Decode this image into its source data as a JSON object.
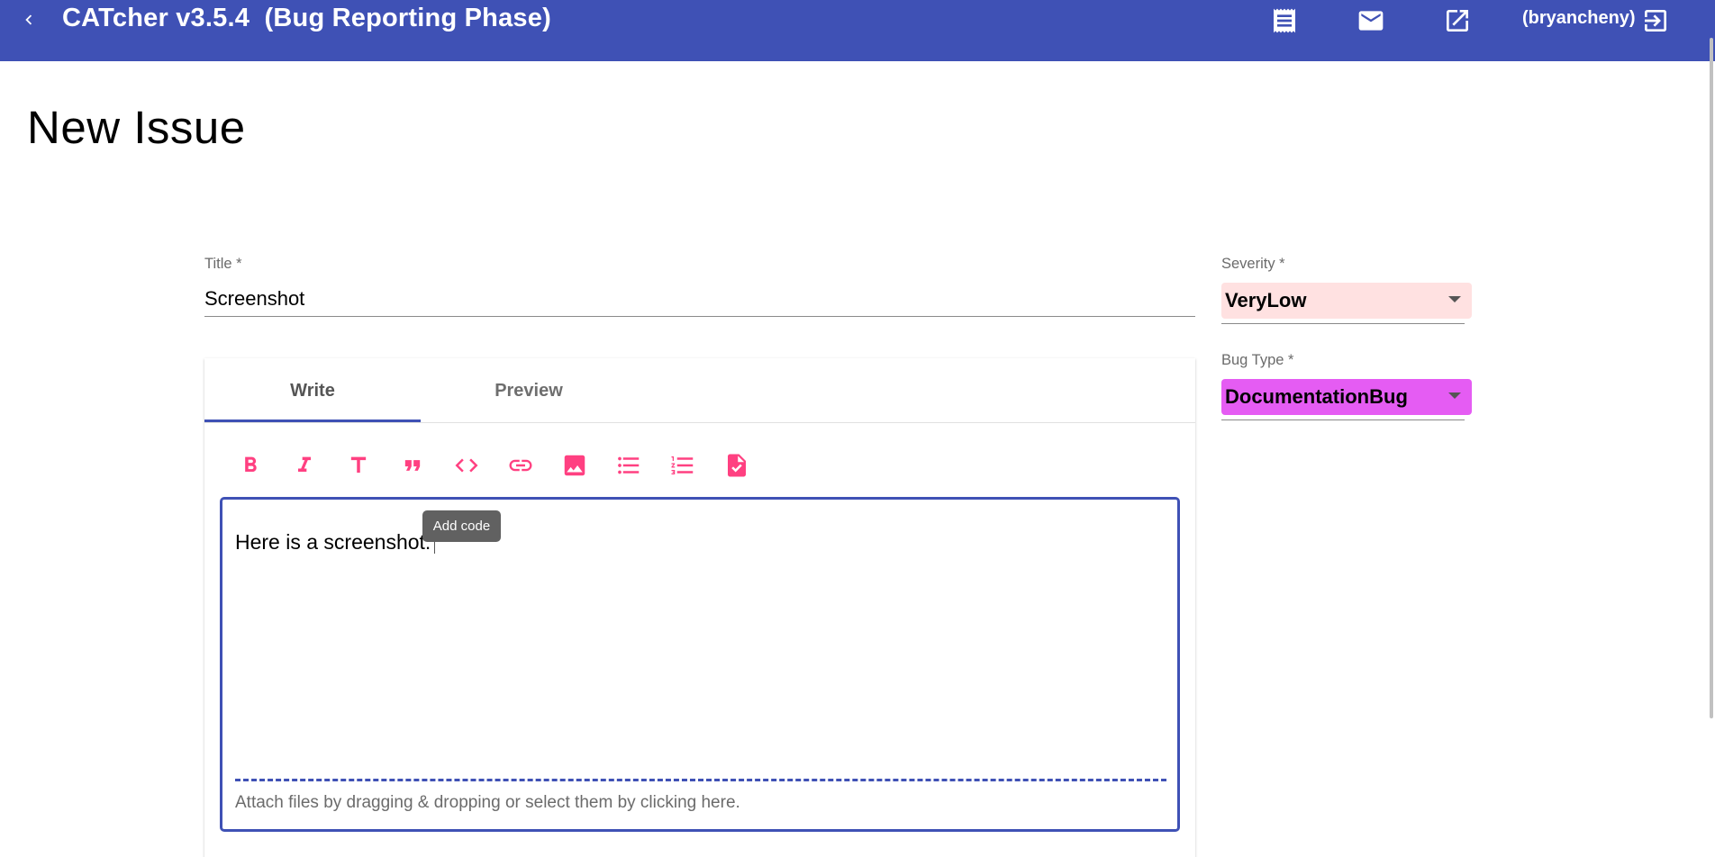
{
  "app": {
    "title": "CATcher v3.5.4  (Bug Reporting Phase)",
    "user": "(bryancheny)",
    "colors": {
      "primary": "#3f51b5",
      "accent": "#ff4081"
    }
  },
  "header_icons": [
    "back-chevron-icon",
    "receipt-icon",
    "mail-icon",
    "open-in-new-icon",
    "logout-icon"
  ],
  "page": {
    "title": "New Issue"
  },
  "form": {
    "title_label": "Title *",
    "title_value": "Screenshot",
    "tabs": [
      {
        "label": "Write",
        "active": true
      },
      {
        "label": "Preview",
        "active": false
      }
    ],
    "toolbar": [
      {
        "name": "bold-icon"
      },
      {
        "name": "italic-icon"
      },
      {
        "name": "heading-icon"
      },
      {
        "name": "quote-icon"
      },
      {
        "name": "code-icon"
      },
      {
        "name": "link-icon"
      },
      {
        "name": "image-icon"
      },
      {
        "name": "bulleted-list-icon"
      },
      {
        "name": "numbered-list-icon"
      },
      {
        "name": "task-list-icon"
      }
    ],
    "body_text": "Here is a screenshot:",
    "tooltip": "Add code",
    "attach_hint": "Attach files by dragging & dropping or select them by clicking here."
  },
  "sidebar": {
    "severity_label": "Severity *",
    "severity_value": "VeryLow",
    "severity_color": "#ffe1e1",
    "bug_type_label": "Bug Type *",
    "bug_type_value": "DocumentationBug",
    "bug_type_color": "#e55cf3"
  }
}
